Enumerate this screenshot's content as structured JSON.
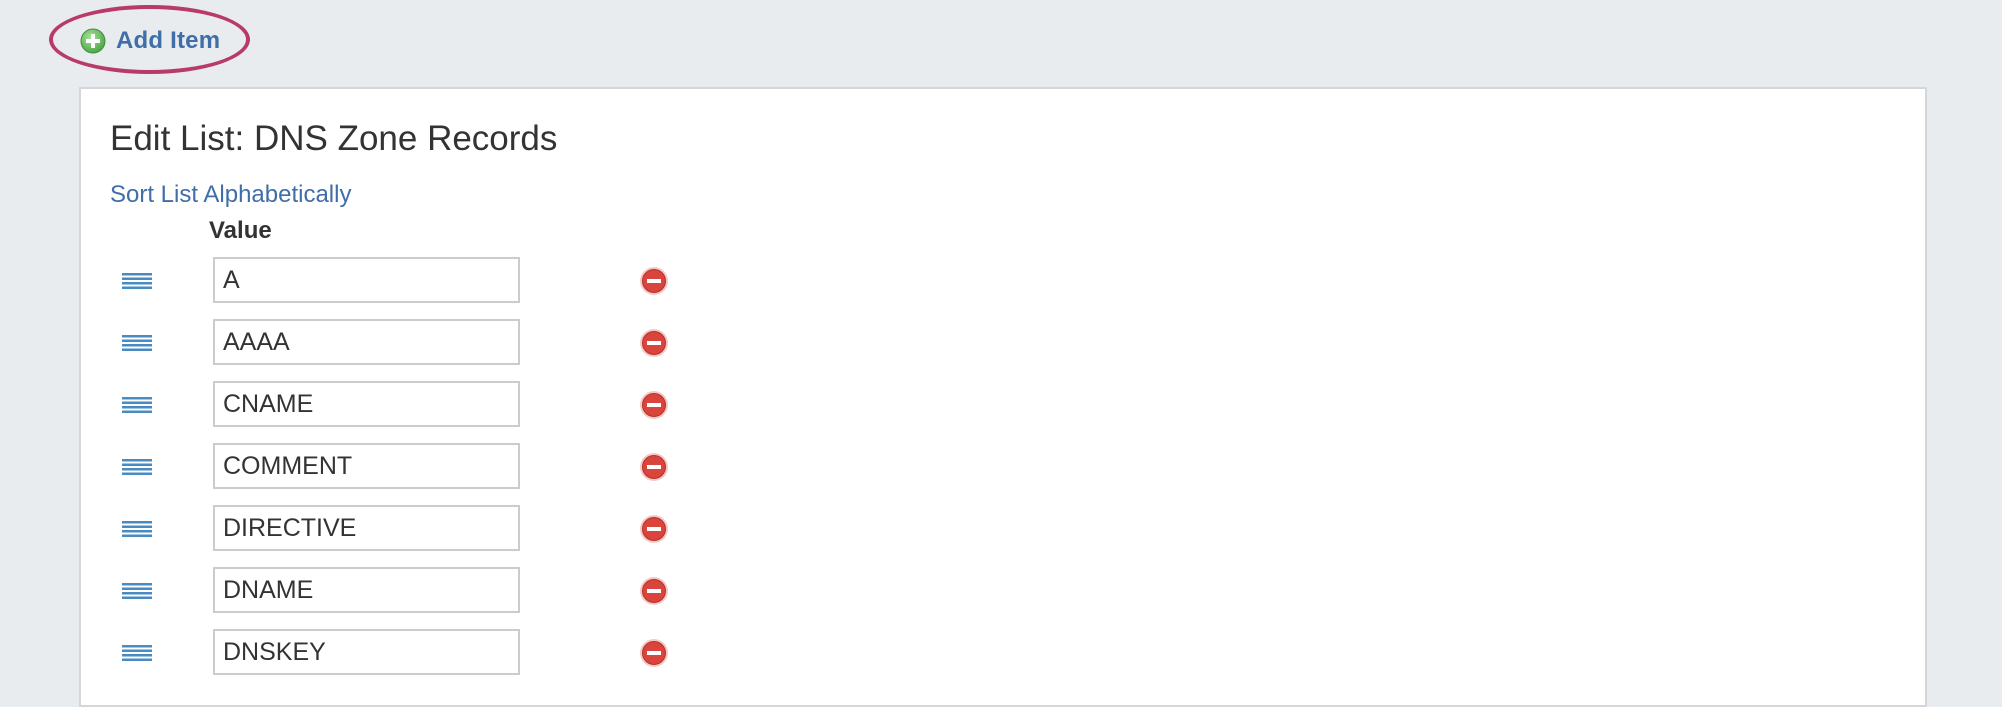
{
  "toolbar": {
    "add_item_label": "Add Item",
    "add_icon": "plus-circle-icon",
    "highlight_color": "#b83a6a",
    "link_color": "#3f6ea8"
  },
  "panel": {
    "title": "Edit List: DNS Zone Records",
    "sort_link": "Sort List Alphabetically",
    "column_header": "Value",
    "drag_icon": "drag-handle-icon",
    "remove_icon": "minus-circle-icon",
    "rows": [
      {
        "value": "A"
      },
      {
        "value": "AAAA"
      },
      {
        "value": "CNAME"
      },
      {
        "value": "COMMENT"
      },
      {
        "value": "DIRECTIVE"
      },
      {
        "value": "DNAME"
      },
      {
        "value": "DNSKEY"
      }
    ]
  },
  "colors": {
    "background": "#e9ecef",
    "panel": "#ffffff",
    "remove": "#d9443c",
    "add": "#5fb557",
    "drag_handle": "#4a8bc2"
  }
}
